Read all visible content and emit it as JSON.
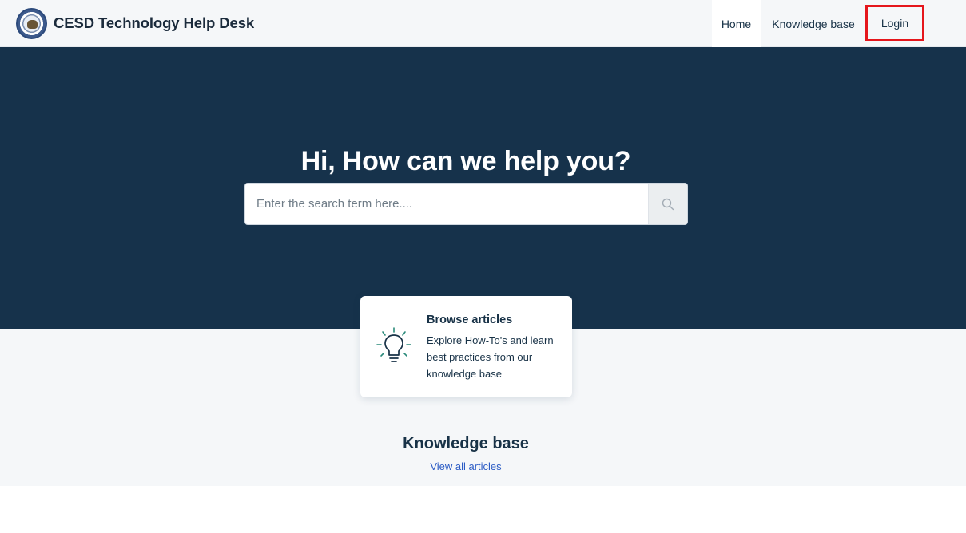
{
  "header": {
    "brand_name": "CESD Technology Help Desk",
    "nav": {
      "home": "Home",
      "knowledge_base": "Knowledge base",
      "login": "Login"
    }
  },
  "hero": {
    "title": "Hi, How can we help you?",
    "search": {
      "placeholder": "Enter the search term here....",
      "value": ""
    }
  },
  "card": {
    "title": "Browse articles",
    "description": "Explore How-To's and learn best practices from our knowledge base"
  },
  "knowledge_base": {
    "title": "Knowledge base",
    "view_all": "View all articles"
  },
  "icons": {
    "logo": "school-seal-logo",
    "search": "search-icon",
    "card": "lightbulb-icon"
  },
  "colors": {
    "hero_bg": "#16324b",
    "page_bg": "#f5f7f9",
    "highlight": "#e5161c",
    "link": "#2c5cc5"
  }
}
